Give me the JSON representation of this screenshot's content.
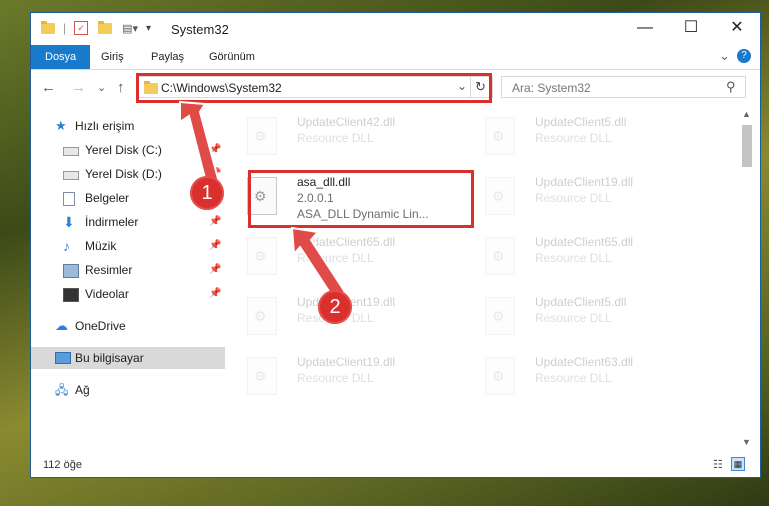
{
  "window": {
    "title": "System32",
    "minimize_glyph": "—",
    "maximize_glyph": "☐",
    "close_glyph": "✕"
  },
  "ribbon": {
    "tabs": [
      "Dosya",
      "Giriş",
      "Paylaş",
      "Görünüm"
    ],
    "expand_glyph": "⌄",
    "help_glyph": "?"
  },
  "navigation": {
    "back_glyph": "←",
    "forward_glyph": "→",
    "recent_glyph": "⌄",
    "up_glyph": "↑",
    "address": "C:\\Windows\\System32",
    "refresh_glyph": "↻",
    "search_placeholder": "Ara: System32",
    "search_glyph": "⚲"
  },
  "sidebar": {
    "items": [
      {
        "label": "Hızlı erişim",
        "icon": "star-icon",
        "pinned": false
      },
      {
        "label": "Yerel Disk (C:)",
        "icon": "drive-icon",
        "pinned": true
      },
      {
        "label": "Yerel Disk (D:)",
        "icon": "drive-icon",
        "pinned": true
      },
      {
        "label": "Belgeler",
        "icon": "documents-icon",
        "pinned": true
      },
      {
        "label": "İndirmeler",
        "icon": "download-icon",
        "pinned": true
      },
      {
        "label": "Müzik",
        "icon": "music-icon",
        "pinned": true
      },
      {
        "label": "Resimler",
        "icon": "pictures-icon",
        "pinned": true
      },
      {
        "label": "Videolar",
        "icon": "videos-icon",
        "pinned": true
      },
      {
        "label": "OneDrive",
        "icon": "cloud-icon",
        "pinned": false
      },
      {
        "label": "Bu bilgisayar",
        "icon": "computer-icon",
        "pinned": false
      },
      {
        "label": "Ağ",
        "icon": "network-icon",
        "pinned": false
      }
    ],
    "pin_glyph": "📌"
  },
  "files": [
    {
      "name": "UpdateClient42.dll",
      "type": "Resource DLL"
    },
    {
      "name": "UpdateClient5.dll",
      "type": "Resource DLL"
    },
    {
      "name": "asa_dll.dll",
      "type": "2.0.0.1",
      "description": "ASA_DLL Dynamic Lin..."
    },
    {
      "name": "UpdateClient19.dll",
      "type": "Resource DLL"
    },
    {
      "name": "UpdateClient65.dll",
      "type": "Resource DLL"
    },
    {
      "name": "UpdateClient65.dll",
      "type": "Resource DLL"
    },
    {
      "name": "UpdateClient19.dll",
      "type": "Resource DLL"
    },
    {
      "name": "UpdateClient5.dll",
      "type": "Resource DLL"
    },
    {
      "name": "UpdateClient19.dll",
      "type": "Resource DLL"
    },
    {
      "name": "UpdateClient63.dll",
      "type": "Resource DLL"
    }
  ],
  "status": {
    "count": "112 öğe"
  },
  "annotations": {
    "badge1": "1",
    "badge2": "2",
    "color": "#d9302d"
  }
}
